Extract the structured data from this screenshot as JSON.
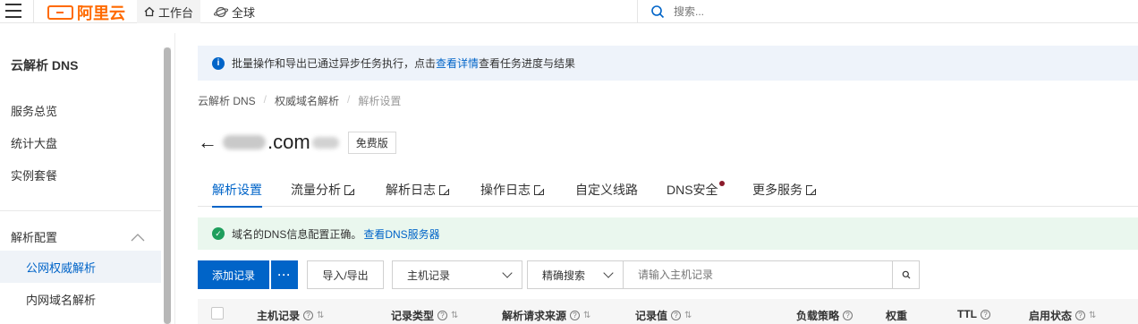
{
  "topbar": {
    "logo_text": "阿里云",
    "workbench_label": "工作台",
    "global_label": "全球",
    "search_placeholder": "搜索..."
  },
  "sidebar": {
    "title": "云解析 DNS",
    "items": [
      "服务总览",
      "统计大盘",
      "实例套餐"
    ],
    "group_label": "解析配置",
    "sub_items": [
      "公网权威解析",
      "内网域名解析"
    ],
    "active_sub": "公网权威解析"
  },
  "banner": {
    "text_before": "批量操作和导出已通过异步任务执行，点击",
    "link": "查看详情",
    "text_after": "查看任务进度与结果"
  },
  "breadcrumb": [
    "云解析 DNS",
    "权威域名解析",
    "解析设置"
  ],
  "domain": {
    "name_visible": ".com",
    "badge": "免费版"
  },
  "tabs": [
    {
      "label": "解析设置",
      "active": true,
      "external": false
    },
    {
      "label": "流量分析",
      "active": false,
      "external": true
    },
    {
      "label": "解析日志",
      "active": false,
      "external": true
    },
    {
      "label": "操作日志",
      "active": false,
      "external": true
    },
    {
      "label": "自定义线路",
      "active": false,
      "external": false
    },
    {
      "label": "DNS安全",
      "active": false,
      "external": false,
      "dot": true
    },
    {
      "label": "更多服务",
      "active": false,
      "external": true
    }
  ],
  "success": {
    "text": "域名的DNS信息配置正确。",
    "link": "查看DNS服务器"
  },
  "toolbar": {
    "add_label": "添加记录",
    "more_label": "···",
    "import_export_label": "导入/导出",
    "field_select": "主机记录",
    "mode_select": "精确搜索",
    "filter_placeholder": "请输入主机记录"
  },
  "table": {
    "columns": [
      "主机记录",
      "记录类型",
      "解析请求来源",
      "记录值",
      "负载策略",
      "权重",
      "TTL",
      "启用状态"
    ]
  },
  "colors": {
    "brand": "#ff6a00",
    "primary": "#0064c8",
    "success": "#1e9e5c",
    "dot": "#8b1a2b"
  }
}
